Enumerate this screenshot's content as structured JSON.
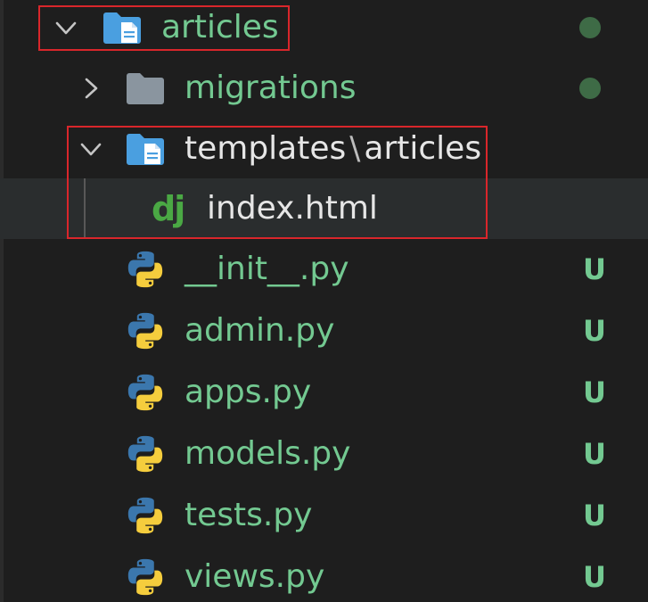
{
  "tree": {
    "articles": {
      "label": "articles",
      "status": "dot"
    },
    "migrations": {
      "label": "migrations",
      "status": "dot"
    },
    "templates": {
      "label_part1": "templates",
      "separator": "\\",
      "label_part2": "articles"
    },
    "index_html": {
      "label": "index.html",
      "icon_text": "dj"
    },
    "files": [
      {
        "label": "__init__.py",
        "status": "U"
      },
      {
        "label": "admin.py",
        "status": "U"
      },
      {
        "label": "apps.py",
        "status": "U"
      },
      {
        "label": "models.py",
        "status": "U"
      },
      {
        "label": "tests.py",
        "status": "U"
      },
      {
        "label": "views.py",
        "status": "U"
      }
    ]
  },
  "colors": {
    "background": "#1e1e1e",
    "selection": "#2a2d2e",
    "untracked_green": "#73c991",
    "folder_blue": "#4a9fe0",
    "folder_gray": "#8a959f",
    "highlight_red": "#d9262b",
    "django_green": "#4aa844",
    "python_blue": "#3b77ad",
    "python_yellow": "#f5cd3d"
  }
}
